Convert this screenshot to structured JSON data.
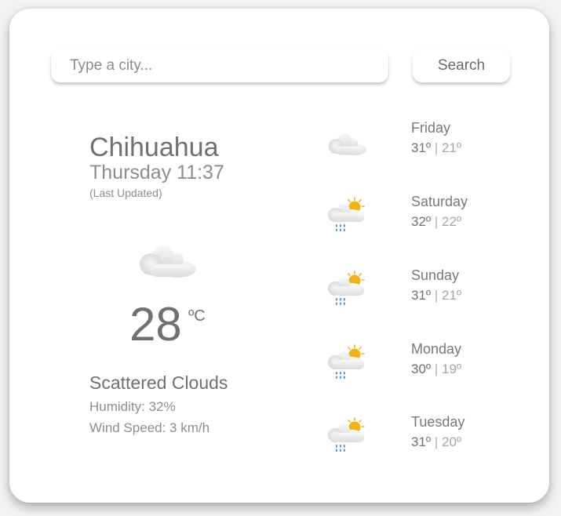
{
  "search": {
    "placeholder": "Type a city...",
    "value": "",
    "button_label": "Search"
  },
  "current": {
    "city": "Chihuahua",
    "datetime": "Thursday 11:37",
    "updated_note": "(Last Updated)",
    "icon": "cloud-icon",
    "temperature": "28",
    "unit": "ºC",
    "condition": "Scattered Clouds",
    "humidity": "Humidity: 32%",
    "wind": "Wind Speed: 3 km/h"
  },
  "forecast": [
    {
      "day": "Friday",
      "high": "31º",
      "separator": "|",
      "low": "21º",
      "icon": "cloud-icon"
    },
    {
      "day": "Saturday",
      "high": "32º",
      "separator": "|",
      "low": "22º",
      "icon": "sun-rain-cloud-icon"
    },
    {
      "day": "Sunday",
      "high": "31º",
      "separator": "|",
      "low": "21º",
      "icon": "sun-rain-cloud-icon"
    },
    {
      "day": "Monday",
      "high": "30º",
      "separator": "|",
      "low": "19º",
      "icon": "sun-rain-cloud-icon"
    },
    {
      "day": "Tuesday",
      "high": "31º",
      "separator": "|",
      "low": "20º",
      "icon": "sun-rain-cloud-icon"
    }
  ],
  "colors": {
    "sun": "#f1b31c",
    "rain": "#3f8fd2",
    "cloud": "#e6e6e6",
    "text_dark": "#6f7075",
    "text_light": "#8c8d91"
  }
}
